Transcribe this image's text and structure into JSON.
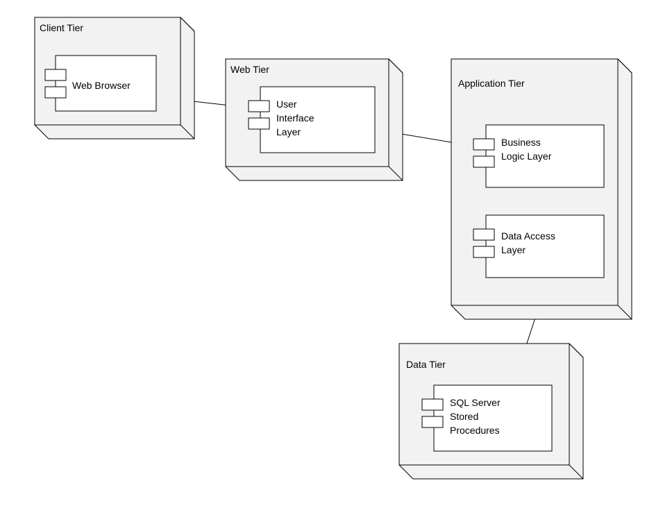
{
  "diagram": {
    "nodes": {
      "client": {
        "title": "Client Tier"
      },
      "web": {
        "title": "Web Tier"
      },
      "application": {
        "title": "Application Tier"
      },
      "data": {
        "title": "Data Tier"
      }
    },
    "components": {
      "web_browser": {
        "label_l1": "Web Browser"
      },
      "ui_layer": {
        "label_l1": "User",
        "label_l2": "Interface",
        "label_l3": "Layer"
      },
      "business_logic": {
        "label_l1": "Business",
        "label_l2": "Logic Layer"
      },
      "data_access": {
        "label_l1": "Data Access",
        "label_l2": "Layer"
      },
      "sql_sp": {
        "label_l1": "SQL Server",
        "label_l2": "Stored",
        "label_l3": "Procedures"
      }
    },
    "connectors": [
      {
        "from": "web_browser",
        "to": "ui_layer"
      },
      {
        "from": "ui_layer",
        "to": "business_logic"
      },
      {
        "from": "business_logic",
        "to": "data_access"
      },
      {
        "from": "data_access",
        "to": "sql_sp"
      }
    ]
  }
}
